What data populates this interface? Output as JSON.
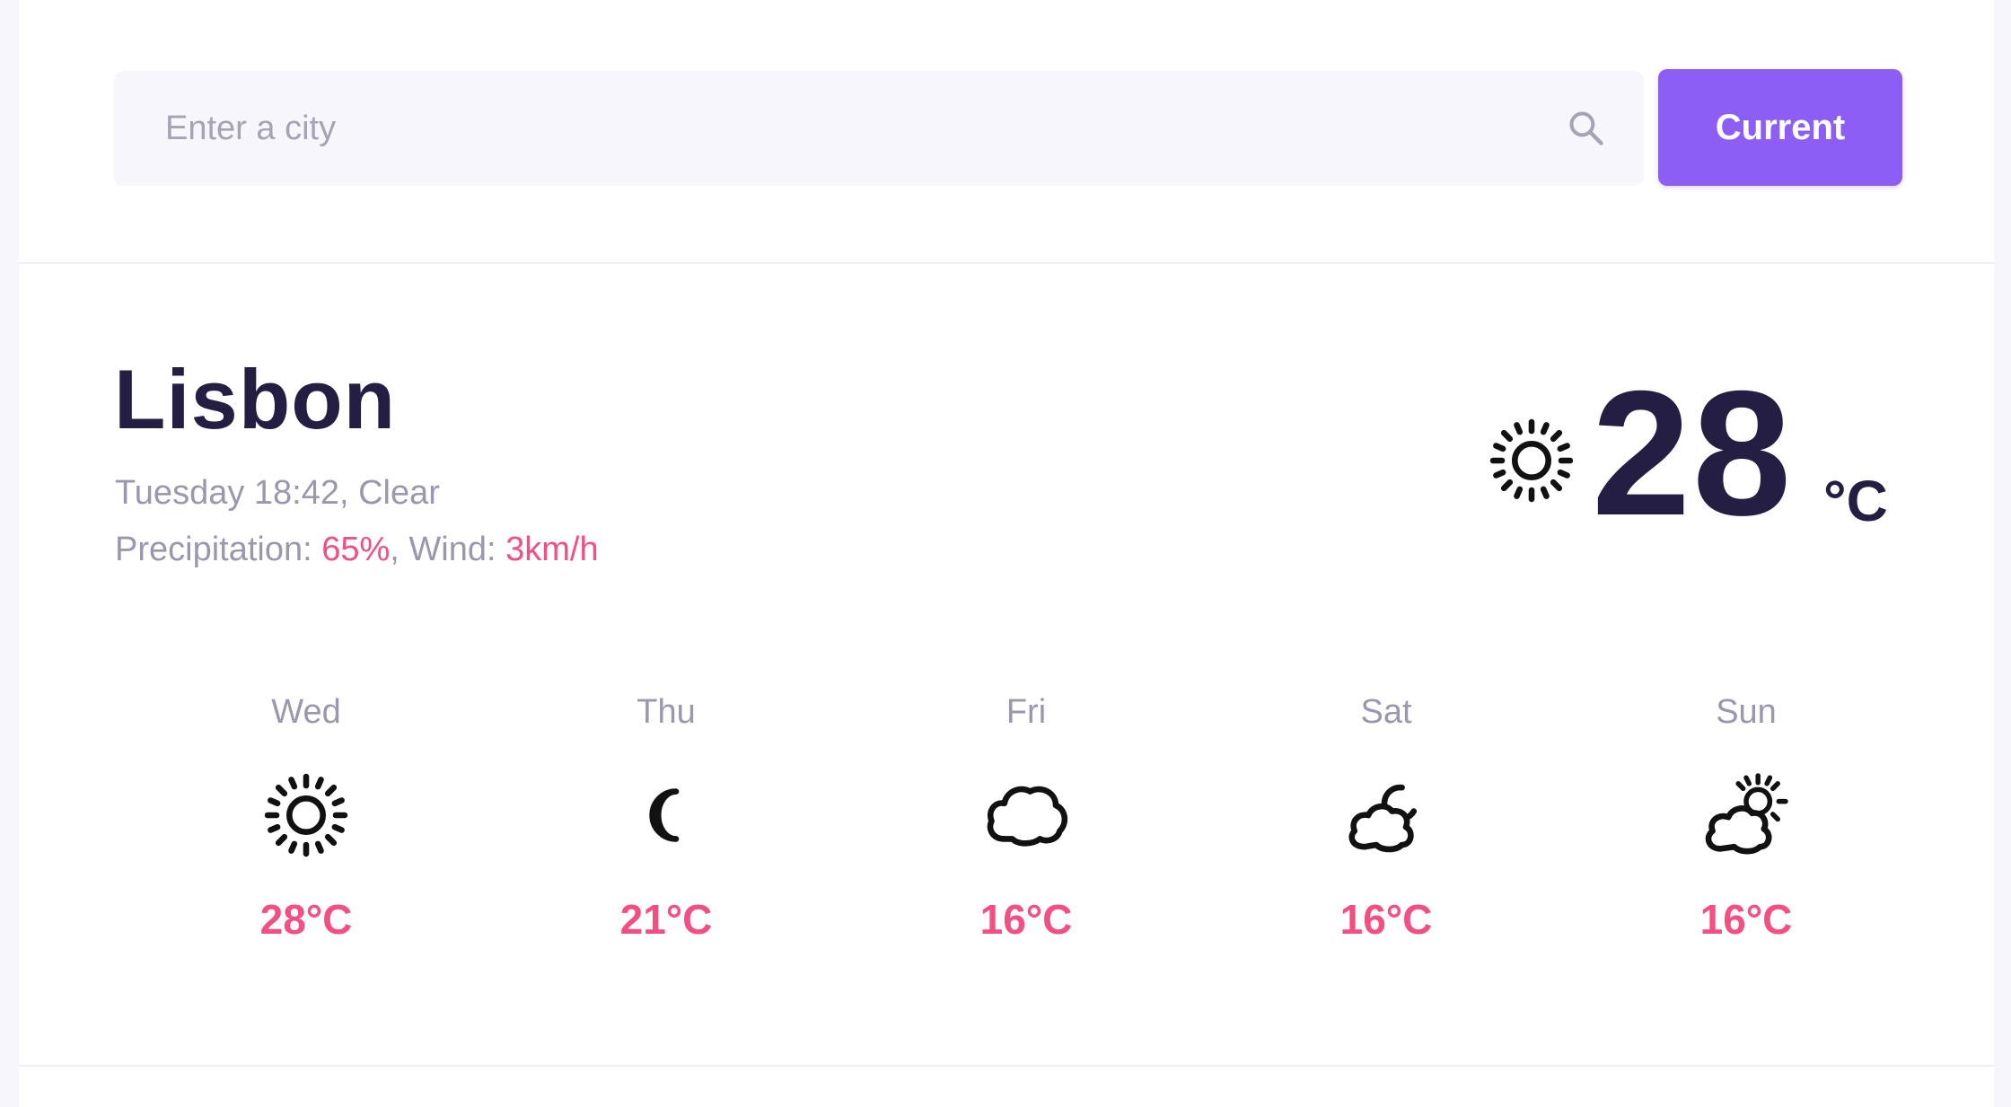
{
  "search": {
    "placeholder": "Enter a city",
    "value": "",
    "icon": "search-icon"
  },
  "current_button_label": "Current",
  "current": {
    "city": "Lisbon",
    "date_text": "Tuesday 18:42, Clear",
    "precip_label": "Precipitation: ",
    "precip_value": "65%",
    "wind_label": ", Wind: ",
    "wind_value": "3km/h",
    "temperature": "28",
    "unit": "°C",
    "icon": "sun-icon"
  },
  "forecast": [
    {
      "day": "Wed",
      "temp": "28°C",
      "icon": "sun-icon"
    },
    {
      "day": "Thu",
      "temp": "21°C",
      "icon": "moon-icon"
    },
    {
      "day": "Fri",
      "temp": "16°C",
      "icon": "cloud-icon"
    },
    {
      "day": "Sat",
      "temp": "16°C",
      "icon": "cloud-moon-icon"
    },
    {
      "day": "Sun",
      "temp": "16°C",
      "icon": "cloud-sun-icon"
    }
  ],
  "colors": {
    "accent_purple": "#8c5ef4",
    "accent_pink": "#f24f83",
    "text_dark": "#241f42",
    "text_muted": "#9a98ad",
    "input_bg": "#f7f7fb"
  }
}
